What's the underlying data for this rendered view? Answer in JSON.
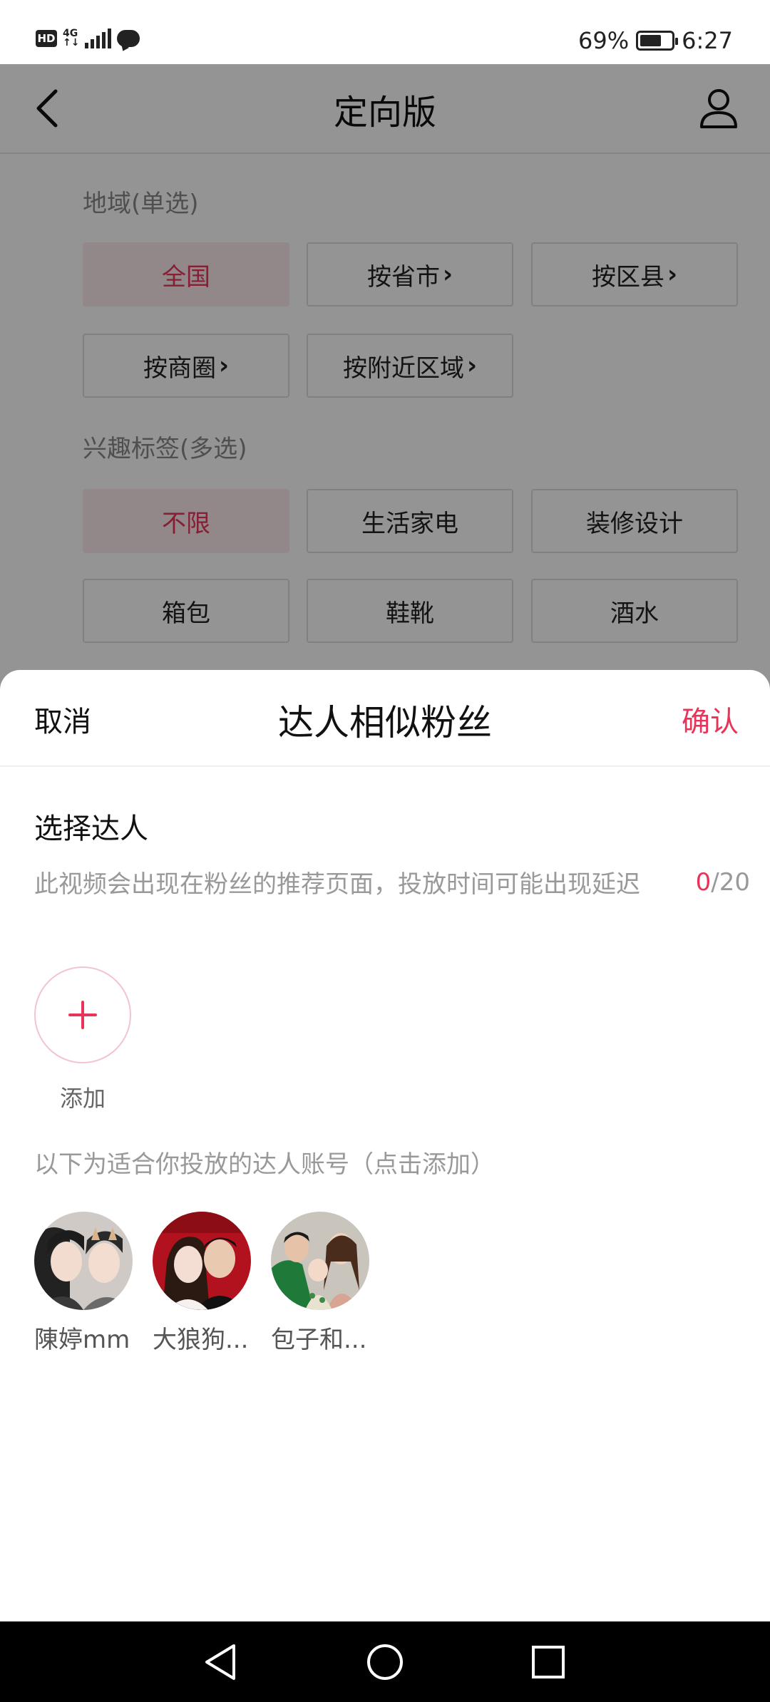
{
  "status_bar": {
    "hd": "HD",
    "network_top": "4G",
    "network_bottom": "↑↓",
    "battery_percent": "69%",
    "battery_level": 0.69,
    "time": "6:27"
  },
  "page": {
    "title": "定向版",
    "region_label": "地域(单选)",
    "region_chips": [
      "全国",
      "按省市",
      "按区县",
      "按商圈",
      "按附近区域"
    ],
    "region_selected": "全国",
    "interest_label": "兴趣标签(多选)",
    "interest_chips": [
      "不限",
      "生活家电",
      "装修设计",
      "箱包",
      "鞋靴",
      "酒水"
    ],
    "interest_selected": "不限"
  },
  "sheet": {
    "cancel_label": "取消",
    "title": "达人相似粉丝",
    "confirm_label": "确认",
    "pick_label": "选择达人",
    "description": "此视频会出现在粉丝的推荐页面，投放时间可能出现延迟",
    "count_current": "0",
    "count_total": "/20",
    "add_label": "添加",
    "recommend_label": "以下为适合你投放的达人账号（点击添加）",
    "creators": [
      {
        "name": "陳婷mm"
      },
      {
        "name": "大狼狗..."
      },
      {
        "name": "包子和..."
      }
    ]
  },
  "colors": {
    "accent": "#e8345a",
    "chip_active_bg": "#fbe9ec",
    "overlay": "rgba(0,0,0,0.42)"
  },
  "icons": {
    "back": "chevron-left-icon",
    "user": "user-icon",
    "add": "plus-icon",
    "nav_back": "triangle-back-icon",
    "nav_home": "circle-home-icon",
    "nav_recent": "square-recent-icon"
  }
}
